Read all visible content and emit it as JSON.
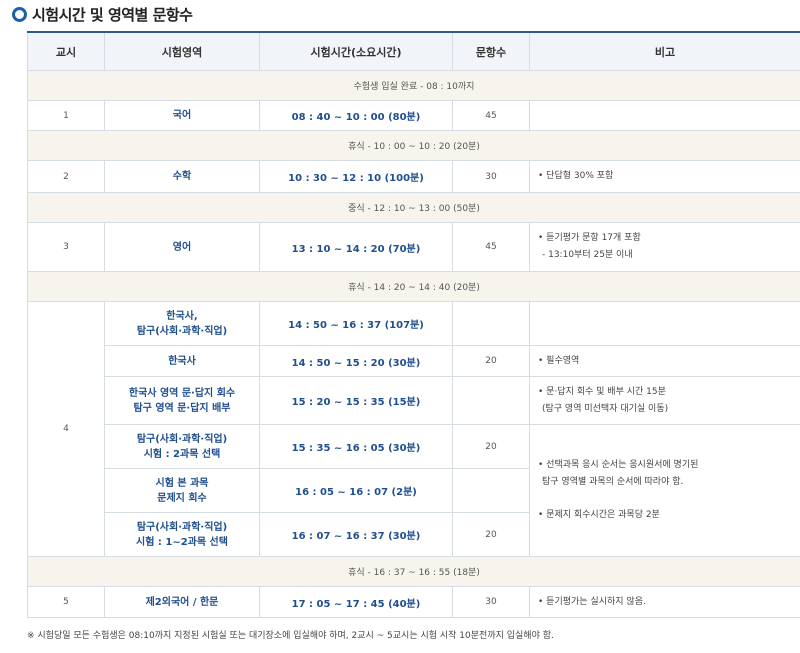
{
  "title": "시험시간 및 영역별 문항수",
  "headers": [
    "교시",
    "시험영역",
    "시험시간(소요시간)",
    "문항수",
    "비고"
  ],
  "break1": "수험생 입실 완료 - 08 : 10까지",
  "p1": {
    "period": "1",
    "subject": "국어",
    "time": "08 : 40 ~ 10 : 00 (80분)",
    "count": "45",
    "note": ""
  },
  "break2": "휴식 - 10 : 00 ~ 10 : 20 (20분)",
  "p2": {
    "period": "2",
    "subject": "수학",
    "time": "10 : 30 ~ 12 : 10 (100분)",
    "count": "30",
    "note": "• 단답형 30% 포함"
  },
  "break3": "중식 - 12 : 10 ~ 13 : 00 (50분)",
  "p3": {
    "period": "3",
    "subject": "영어",
    "time": "13 : 10 ~ 14 : 20 (70분)",
    "count": "45",
    "note1": "• 듣기평가 문항 17개 포함",
    "note2": "- 13:10부터 25분 이내"
  },
  "break4": "휴식 - 14 : 20 ~ 14 : 40 (20분)",
  "p4": {
    "period": "4",
    "r1": {
      "subject1": "한국사,",
      "subject2": "탐구(사회·과학·직업)",
      "time": "14 : 50 ~ 16 : 37 (107분)"
    },
    "r2": {
      "subject": "한국사",
      "time": "14 : 50 ~ 15 : 20 (30분)",
      "count": "20",
      "note": "• 필수영역"
    },
    "r3": {
      "subject1": "한국사 영역 문·답지 회수",
      "subject2": "탐구 영역 문·답지 배부",
      "time": "15 : 20 ~ 15 : 35 (15분)",
      "note1": "• 문·답지 회수 및 배부 시간 15분",
      "note2": "(탐구 영역 미선택자 대기실 이동)"
    },
    "r4": {
      "subject1": "탐구(사회·과학·직업)",
      "subject2": "시험 : 2과목 선택",
      "time": "15 : 35 ~ 16 : 05 (30분)",
      "count": "20"
    },
    "r5": {
      "subject1": "시험 본 과목",
      "subject2": "문제지 회수",
      "time": "16 : 05 ~ 16 : 07 (2분)"
    },
    "r6": {
      "subject1": "탐구(사회·과학·직업)",
      "subject2": "시험 : 1~2과목 선택",
      "time": "16 : 07 ~ 16 : 37 (30분)",
      "count": "20"
    },
    "note_a1": "• 선택과목 응시 순서는 응시원서에 명기된",
    "note_a2": "탐구 영역별 과목의 순서에 따라야 함.",
    "note_b": "• 문제지 회수시간은 과목당 2분"
  },
  "break5": "휴식 - 16 : 37 ~ 16 : 55 (18분)",
  "p5": {
    "period": "5",
    "subject": "제2외국어 / 한문",
    "time": "17 : 05 ~ 17 : 45 (40분)",
    "count": "30",
    "note": "• 듣기평가는 실시하지 않음."
  },
  "footer": "※ 시험당일 모든 수험생은 08:10까지 지정된 시험실 또는 대기장소에 입실해야 하며, 2교시 ~ 5교시는 시험 시작 10분전까지 입실해야 함."
}
